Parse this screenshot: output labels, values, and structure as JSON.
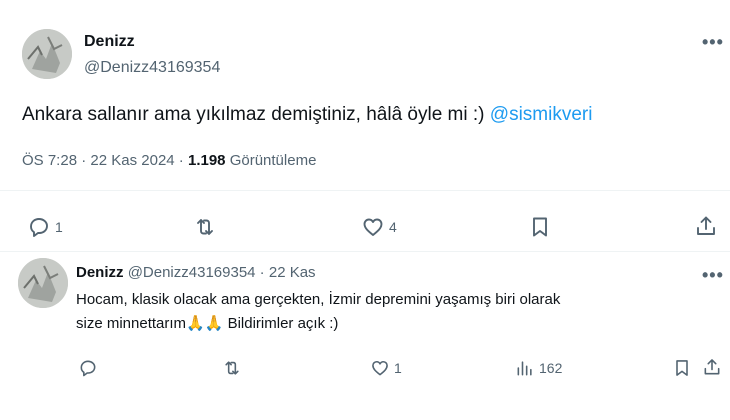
{
  "main_tweet": {
    "name": "Denizz",
    "handle": "@Denizz43169354",
    "text_prefix": "Ankara sallanır ama yıkılmaz demiştiniz, hâlâ öyle mi :) ",
    "mention": "@sismikveri",
    "time": "ÖS 7:28",
    "dot1": " · ",
    "date": "22 Kas 2024",
    "dot2": " · ",
    "views": "1.198",
    "views_label": " Görüntüleme",
    "actions": {
      "replies": "1",
      "retweets": "",
      "likes": "4"
    },
    "more_glyph": "•••"
  },
  "reply_tweet": {
    "name": "Denizz",
    "handle": "@Denizz43169354",
    "separator": " · ",
    "date": "22 Kas",
    "line1": "Hocam, klasik olacak ama gerçekten, İzmir depremini yaşamış biri olarak",
    "line2_prefix": "size minnettarım",
    "emoji": "🙏🙏",
    "line2_suffix": " Bildirimler açık :)",
    "actions": {
      "replies": "",
      "retweets": "",
      "likes": "1",
      "views": "162"
    },
    "more_glyph": "•••"
  },
  "icons": [
    "reply-icon",
    "retweet-icon",
    "like-icon",
    "bookmark-icon",
    "share-icon",
    "views-icon",
    "more-icon"
  ],
  "colors": {
    "text": "#0f1419",
    "secondary": "#536471",
    "link": "#1d9bf0",
    "divider": "#eff3f4"
  }
}
